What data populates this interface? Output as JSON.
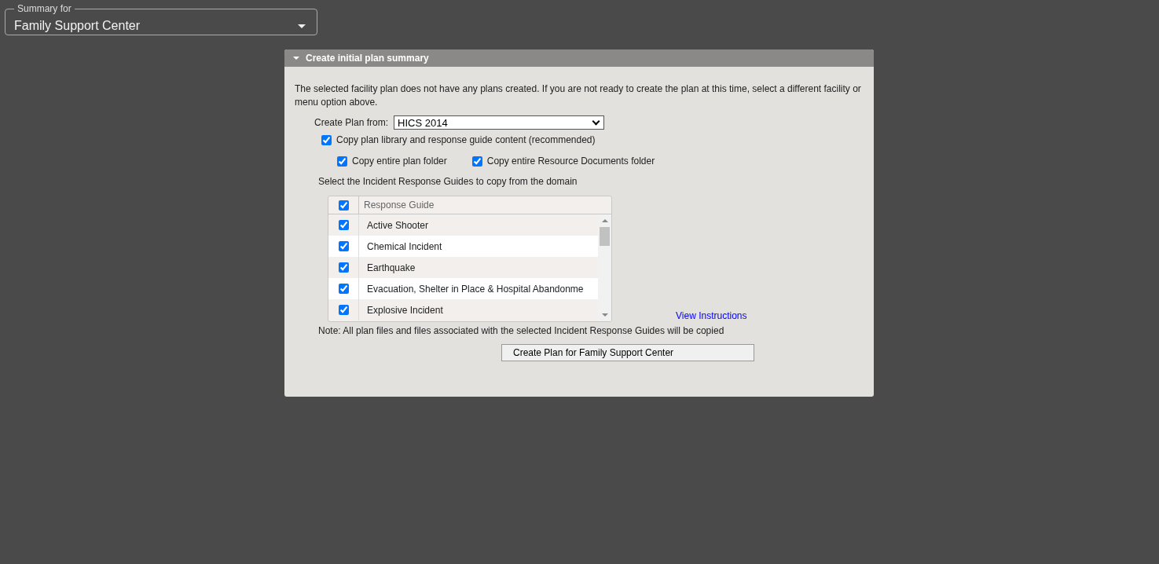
{
  "summary_for": {
    "label": "Summary for",
    "value": "Family Support Center"
  },
  "panel": {
    "title": "Create initial plan summary",
    "expanded": true,
    "intro": "The selected facility plan does not have any plans created. If you are not ready to create the plan at this time, select a different facility or menu option above.",
    "plan_source": {
      "label": "Create Plan from:",
      "value": "HICS 2014"
    },
    "copy_library": {
      "label": "Copy plan library and response guide content (recommended)",
      "checked": true
    },
    "copy_options": [
      {
        "label": "Copy entire plan folder",
        "checked": true
      },
      {
        "label": "Copy entire Resource Documents folder",
        "checked": true
      }
    ],
    "guides_prompt": "Select the Incident Response Guides to copy from the domain",
    "table": {
      "select_all_checked": true,
      "column": "Response Guide",
      "rows": [
        {
          "name": "Active Shooter",
          "checked": true
        },
        {
          "name": "Chemical Incident",
          "checked": true
        },
        {
          "name": "Earthquake",
          "checked": true
        },
        {
          "name": "Evacuation, Shelter in Place & Hospital Abandonme",
          "checked": true
        },
        {
          "name": "Explosive Incident",
          "checked": true
        }
      ]
    },
    "instructions_link": "View Instructions",
    "note": "Note: All plan files and files associated with the selected Incident Response Guides will be copied",
    "create_button": "Create Plan for Family Support Center"
  }
}
